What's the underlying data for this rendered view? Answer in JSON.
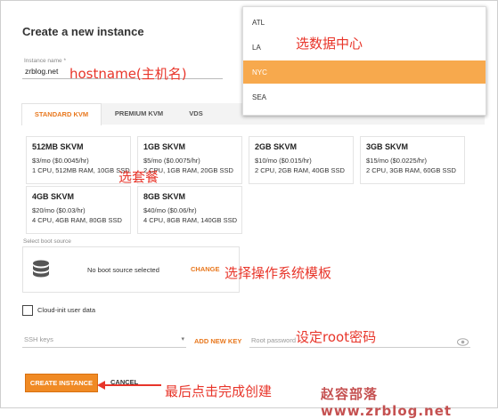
{
  "dialog": {
    "title": "Create a new instance",
    "hostname_label": "Instance name *",
    "hostname_value": "zrblog.net"
  },
  "dropdown": {
    "items": [
      "ATL",
      "LA",
      "NYC",
      "SEA"
    ],
    "selected": "NYC"
  },
  "tabs": [
    "STANDARD KVM",
    "PREMIUM KVM",
    "VDS"
  ],
  "plans": [
    {
      "name": "512MB SKVM",
      "price": "$3/mo ($0.0045/hr)",
      "specs": "1 CPU, 512MB RAM, 10GB SSD"
    },
    {
      "name": "1GB SKVM",
      "price": "$5/mo ($0.0075/hr)",
      "specs": "2 CPU, 1GB RAM, 20GB SSD"
    },
    {
      "name": "2GB SKVM",
      "price": "$10/mo ($0.015/hr)",
      "specs": "2 CPU, 2GB RAM, 40GB SSD"
    },
    {
      "name": "3GB SKVM",
      "price": "$15/mo ($0.0225/hr)",
      "specs": "2 CPU, 3GB RAM, 60GB SSD"
    },
    {
      "name": "4GB SKVM",
      "price": "$20/mo ($0.03/hr)",
      "specs": "4 CPU, 4GB RAM, 80GB SSD"
    },
    {
      "name": "8GB SKVM",
      "price": "$40/mo ($0.06/hr)",
      "specs": "4 CPU, 8GB RAM, 140GB SSD"
    }
  ],
  "boot": {
    "label": "Select boot source",
    "text": "No boot source selected",
    "change": "CHANGE"
  },
  "cloudinit": "Cloud-init user data",
  "ssh": {
    "placeholder": "SSH keys",
    "add": "ADD NEW KEY"
  },
  "password_placeholder": "Root password",
  "buttons": {
    "create": "CREATE INSTANCE",
    "cancel": "CANCEL"
  },
  "annotations": {
    "hostname": "hostname(主机名)",
    "datacenter": "选数据中心",
    "plan": "选套餐",
    "os": "选择操作系统模板",
    "root": "设定root密码",
    "finish": "最后点击完成创建"
  },
  "watermark": "赵容部落www.zrblog.net",
  "colors": {
    "accent": "#e8781e",
    "selected": "#f7a94d",
    "annotation": "#e8352a"
  }
}
